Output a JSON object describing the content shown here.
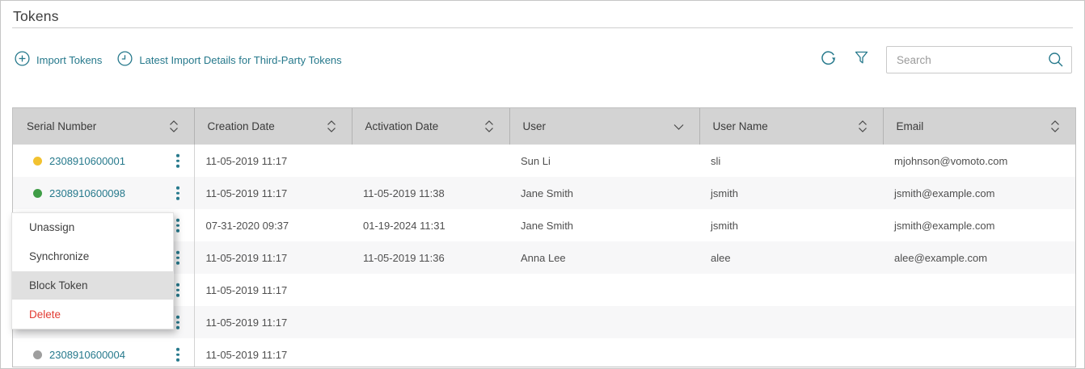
{
  "title": "Tokens",
  "toolbar": {
    "import_tokens": "Import Tokens",
    "latest_import_details": "Latest Import Details for Third-Party Tokens",
    "search_placeholder": "Search"
  },
  "table": {
    "columns": [
      {
        "label": "Serial Number",
        "sort": "double"
      },
      {
        "label": "Creation Date",
        "sort": "double"
      },
      {
        "label": "Activation Date",
        "sort": "double"
      },
      {
        "label": "User",
        "sort": "single"
      },
      {
        "label": "User Name",
        "sort": "double"
      },
      {
        "label": "Email",
        "sort": "double"
      }
    ],
    "rows": [
      {
        "status": "#f2c230",
        "serial": "2308910600001",
        "creation_date": "11-05-2019 11:17",
        "activation_date": "",
        "user": "Sun Li",
        "user_name": "sli",
        "email": "mjohnson@vomoto.com"
      },
      {
        "status": "#3f9d46",
        "serial": "2308910600098",
        "creation_date": "11-05-2019 11:17",
        "activation_date": "11-05-2019 11:38",
        "user": "Jane Smith",
        "user_name": "jsmith",
        "email": "jsmith@example.com"
      },
      {
        "creation_date": "07-31-2020 09:37",
        "activation_date": "01-19-2024 11:31",
        "user": "Jane Smith",
        "user_name": "jsmith",
        "email": "jsmith@example.com"
      },
      {
        "creation_date": "11-05-2019 11:17",
        "activation_date": "11-05-2019 11:36",
        "user": "Anna Lee",
        "user_name": "alee",
        "email": "alee@example.com"
      },
      {
        "creation_date": "11-05-2019 11:17",
        "activation_date": "",
        "user": "",
        "user_name": "",
        "email": ""
      },
      {
        "creation_date": "11-05-2019 11:17",
        "activation_date": "",
        "user": "",
        "user_name": "",
        "email": ""
      },
      {
        "status": "#9e9e9e",
        "serial": "2308910600004",
        "creation_date": "11-05-2019 11:17",
        "activation_date": "",
        "user": "",
        "user_name": "",
        "email": ""
      }
    ]
  },
  "context_menu": {
    "items": [
      {
        "label": "Unassign",
        "state": "normal"
      },
      {
        "label": "Synchronize",
        "state": "normal"
      },
      {
        "label": "Block Token",
        "state": "highlighted"
      },
      {
        "label": "Delete",
        "state": "danger"
      }
    ]
  },
  "colors": {
    "accent_teal": "#26798c",
    "header_bg": "#d3d3d3",
    "row_alt_bg": "#f7f7f8",
    "menu_highlight": "#e0e0e0",
    "danger_red": "#e23b32",
    "status_yellow": "#f2c230",
    "status_green": "#3f9d46",
    "status_gray": "#9e9e9e"
  }
}
